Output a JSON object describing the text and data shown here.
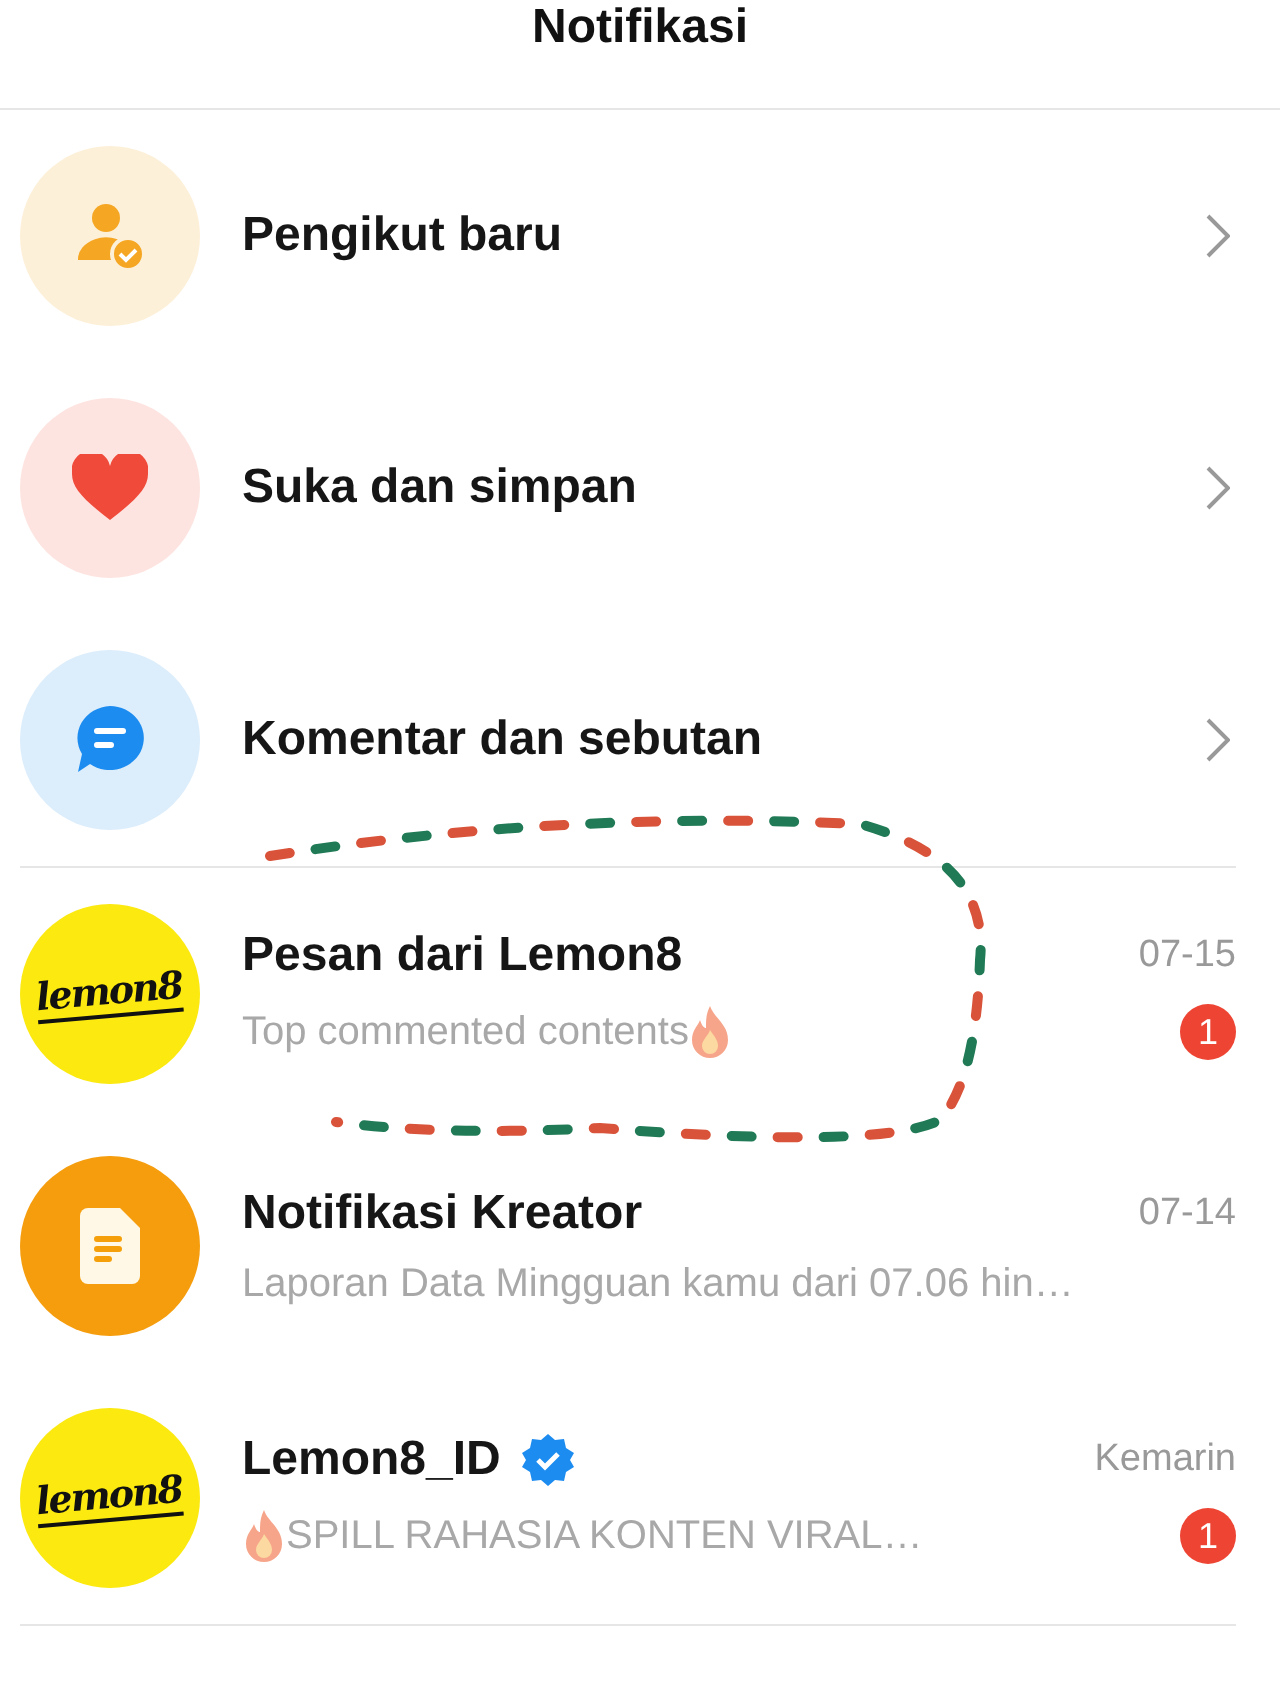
{
  "header": {
    "title": "Notifikasi"
  },
  "categories": [
    {
      "kind": "follower",
      "label": "Pengikut baru"
    },
    {
      "kind": "like",
      "label": "Suka dan simpan"
    },
    {
      "kind": "comment",
      "label": "Komentar dan sebutan"
    }
  ],
  "messages": [
    {
      "kind": "logo",
      "avatar_text": "lemon8",
      "title": "Pesan dari Lemon8",
      "verified": false,
      "date": "07-15",
      "preview": "Top commented contents",
      "leading_flame": false,
      "trailing_flame": true,
      "badge": "1"
    },
    {
      "kind": "document",
      "title": "Notifikasi Kreator",
      "verified": false,
      "date": "07-14",
      "preview": "Laporan Data Mingguan kamu dari 07.06 hin…",
      "leading_flame": false,
      "trailing_flame": false
    },
    {
      "kind": "logo",
      "avatar_text": "lemon8",
      "title": "Lemon8_ID",
      "verified": true,
      "date": "Kemarin",
      "preview": "SPILL RAHASIA KONTEN VIRAL…",
      "leading_flame": true,
      "trailing_flame": false,
      "badge": "1"
    }
  ],
  "annotation": {
    "kind": "dashed-loop"
  }
}
